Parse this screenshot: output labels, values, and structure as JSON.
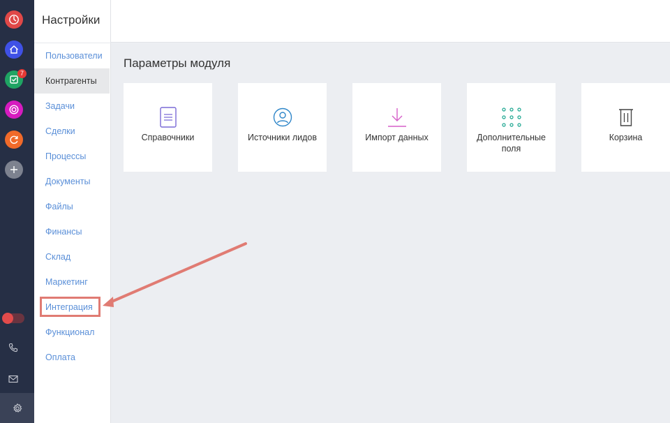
{
  "sidebar": {
    "title": "Настройки",
    "items": [
      {
        "label": "Пользователи"
      },
      {
        "label": "Контрагенты"
      },
      {
        "label": "Задачи"
      },
      {
        "label": "Сделки"
      },
      {
        "label": "Процессы"
      },
      {
        "label": "Документы"
      },
      {
        "label": "Файлы"
      },
      {
        "label": "Финансы"
      },
      {
        "label": "Склад"
      },
      {
        "label": "Маркетинг"
      },
      {
        "label": "Интеграция"
      },
      {
        "label": "Функционал"
      },
      {
        "label": "Оплата"
      }
    ],
    "active_item": "Контрагенты",
    "highlighted_item": "Интеграция"
  },
  "rail": {
    "tasks_badge": "7",
    "apps": [
      {
        "icon": "timer-icon",
        "color": "#e04848"
      },
      {
        "icon": "home-icon",
        "color": "#3f51e6"
      },
      {
        "icon": "tasks-check-icon",
        "color": "#1fa463"
      },
      {
        "icon": "target-icon",
        "color": "#d61bbf"
      },
      {
        "icon": "refresh-icon",
        "color": "#f06a2a"
      },
      {
        "icon": "add-icon",
        "color": "#7d828f"
      }
    ]
  },
  "main": {
    "section_title": "Параметры модуля",
    "cards": [
      {
        "label": "Справочники",
        "icon": "document-list-icon",
        "color": "#7a6ad6"
      },
      {
        "label": "Источники лидов",
        "icon": "user-circle-icon",
        "color": "#2e86c9"
      },
      {
        "label": "Импорт данных",
        "icon": "download-icon",
        "color": "#d65fc9"
      },
      {
        "label": "Дополнительные поля",
        "icon": "dots-grid-icon",
        "color": "#1aa58f"
      },
      {
        "label": "Корзина",
        "icon": "trash-icon",
        "color": "#444444"
      }
    ]
  },
  "colors": {
    "rail_bg": "#262f45",
    "link": "#5a8fd8",
    "highlight": "#e07b73"
  }
}
